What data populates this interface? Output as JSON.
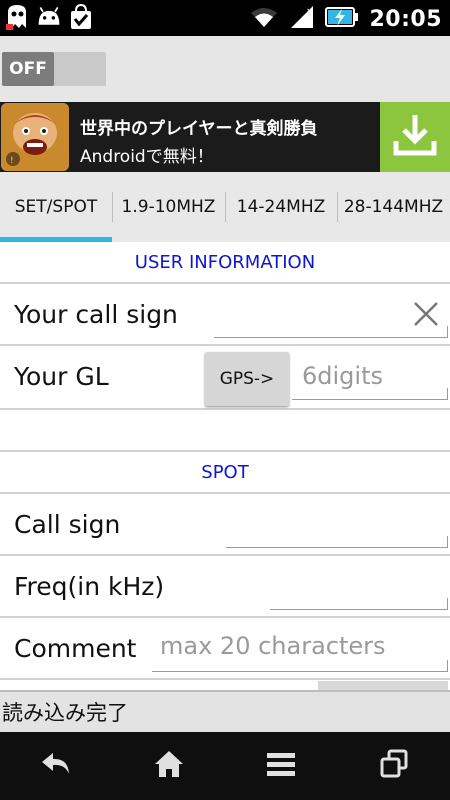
{
  "status_bar": {
    "time": "20:05",
    "icons": [
      "ghost-app-icon",
      "android-icon",
      "shopping-bag-check-icon",
      "wifi-icon",
      "signal-icon",
      "battery-charging-icon"
    ]
  },
  "toggle": {
    "label": "OFF",
    "state": "off"
  },
  "ad": {
    "line1": "世界中のプレイヤーと真剣勝負",
    "line2": "Androidで無料！",
    "icon": "clash-game-icon",
    "action_icon": "download-icon",
    "action_color": "#8cc63e"
  },
  "tabs": [
    {
      "label": "SET/SPOT",
      "active": true
    },
    {
      "label": "1.9-10MHZ",
      "active": false
    },
    {
      "label": "14-24MHZ",
      "active": false
    },
    {
      "label": "28-144MHZ",
      "active": false
    }
  ],
  "user_info": {
    "header": "USER INFORMATION",
    "call_sign_label": "Your call sign",
    "call_sign_value": "",
    "gl_label": "Your GL",
    "gps_button": "GPS->",
    "gl_placeholder": "6digits"
  },
  "spot": {
    "header": "SPOT",
    "call_sign_label": "Call sign",
    "freq_label": "Freq(in kHz)",
    "comment_label": "Comment",
    "comment_placeholder": "max 20 characters"
  },
  "status_message": "読み込み完了",
  "colors": {
    "accent": "#33b5e5",
    "header_text": "#0b16d6"
  }
}
